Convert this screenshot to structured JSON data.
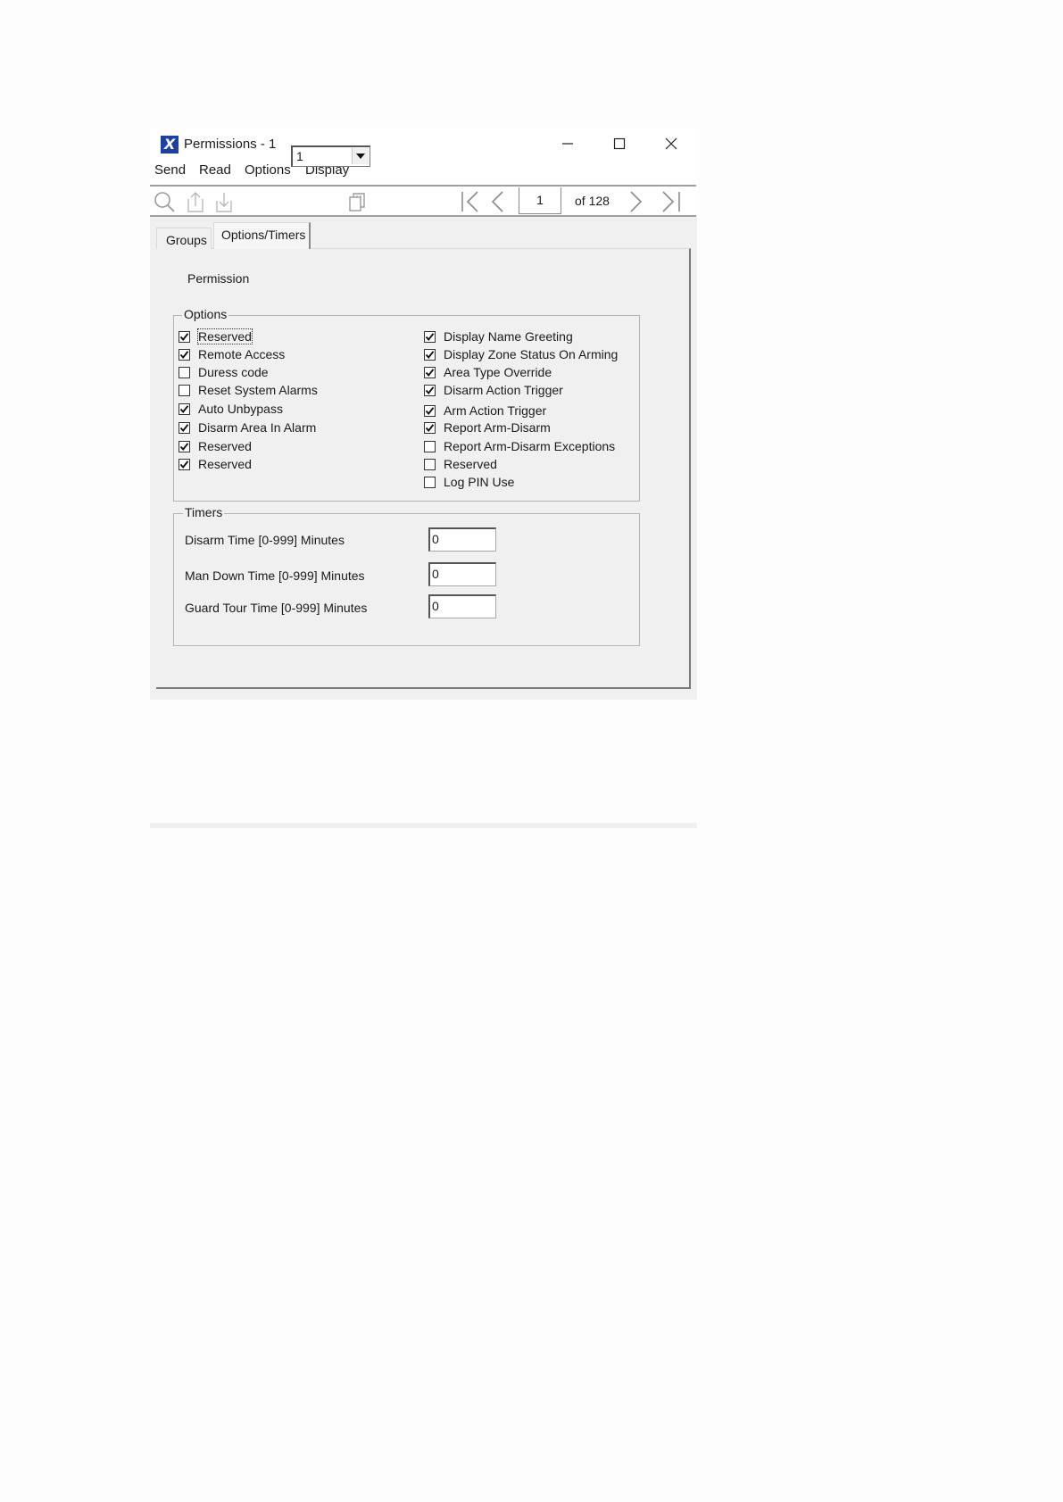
{
  "window": {
    "title": "Permissions - 1",
    "app_icon": "X"
  },
  "menu": [
    "Send",
    "Read",
    "Options",
    "Display"
  ],
  "toolbar": {
    "icons": [
      "search-icon",
      "send-icon",
      "read-icon",
      "copy-icon",
      "first-page-icon",
      "previous-page-icon",
      "next-page-icon",
      "last-page-icon"
    ],
    "page_value": "1",
    "page_of": "of 128"
  },
  "tabs": [
    {
      "label": "Groups",
      "active": false
    },
    {
      "label": "Options/Timers",
      "active": true
    }
  ],
  "permission": {
    "label": "Permission",
    "value": "1"
  },
  "options": {
    "legend": "Options",
    "left": [
      {
        "label": "Reserved",
        "checked": true
      },
      {
        "label": "Remote Access",
        "checked": true
      },
      {
        "label": "Duress code",
        "checked": false
      },
      {
        "label": "Reset System Alarms",
        "checked": false
      },
      {
        "label": "Auto Unbypass",
        "checked": true
      },
      {
        "label": "Disarm Area In Alarm",
        "checked": true
      },
      {
        "label": "Reserved",
        "checked": true
      },
      {
        "label": "Reserved",
        "checked": true
      }
    ],
    "right": [
      {
        "label": "Display Name Greeting",
        "checked": true
      },
      {
        "label": "Display Zone Status On Arming",
        "checked": true
      },
      {
        "label": "Area Type Override",
        "checked": true
      },
      {
        "label": "Disarm Action Trigger",
        "checked": true
      },
      {
        "label": "Arm Action Trigger",
        "checked": true
      },
      {
        "label": "Report Arm-Disarm",
        "checked": true
      },
      {
        "label": "Report Arm-Disarm Exceptions",
        "checked": false
      },
      {
        "label": "Reserved",
        "checked": false
      },
      {
        "label": "Log PIN Use",
        "checked": false
      }
    ]
  },
  "timers": {
    "legend": "Timers",
    "items": [
      {
        "label": "Disarm Time [0-999] Minutes",
        "value": "0"
      },
      {
        "label": "Man Down Time [0-999] Minutes",
        "value": "0"
      },
      {
        "label": "Guard Tour Time  [0-999] Minutes",
        "value": "0"
      }
    ]
  }
}
